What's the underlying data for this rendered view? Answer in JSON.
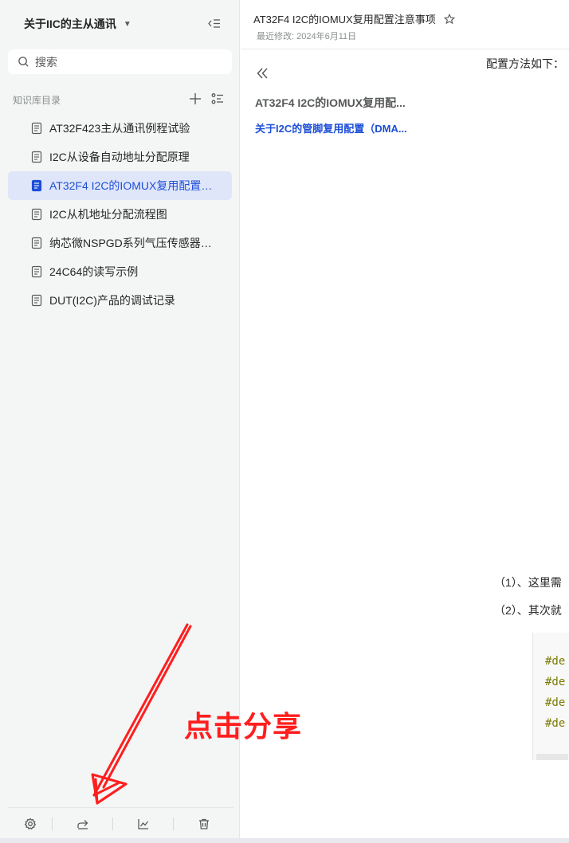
{
  "sidebar": {
    "kb_title": "关于IIC的主从通讯",
    "search_placeholder": "搜索",
    "toc_label": "知识库目录",
    "items": [
      {
        "label": "AT32F423主从通讯例程试验",
        "active": false
      },
      {
        "label": "I2C从设备自动地址分配原理",
        "active": false
      },
      {
        "label": "AT32F4 I2C的IOMUX复用配置注...",
        "active": true
      },
      {
        "label": "I2C从机地址分配流程图",
        "active": false
      },
      {
        "label": "纳芯微NSPGD系列气压传感器的I...",
        "active": false
      },
      {
        "label": "24C64的读写示例",
        "active": false
      },
      {
        "label": "DUT(I2C)产品的调试记录",
        "active": false
      }
    ],
    "bottom_icons": [
      "gear-icon",
      "share-icon",
      "chart-icon",
      "trash-icon"
    ]
  },
  "document": {
    "title": "AT32F4 I2C的IOMUX复用配置注意事项",
    "last_modified": "最近修改: 2024年6月11日",
    "outline": {
      "h1": "AT32F4 I2C的IOMUX复用配...",
      "h2": "关于I2C的管脚复用配置（DMA..."
    },
    "body": {
      "intro": "配置方法如下：",
      "step1": "（1）、这里需",
      "step2": "（2）、其次就"
    },
    "code_lines": [
      "#de",
      "#de",
      "#de",
      "#de"
    ]
  },
  "annotation": {
    "text": "点击分享",
    "color": "#ff1e1e"
  },
  "colors": {
    "accent": "#1d4fd8",
    "active_bg": "#e0e6f9",
    "sidebar_bg": "#f4f5f5"
  }
}
